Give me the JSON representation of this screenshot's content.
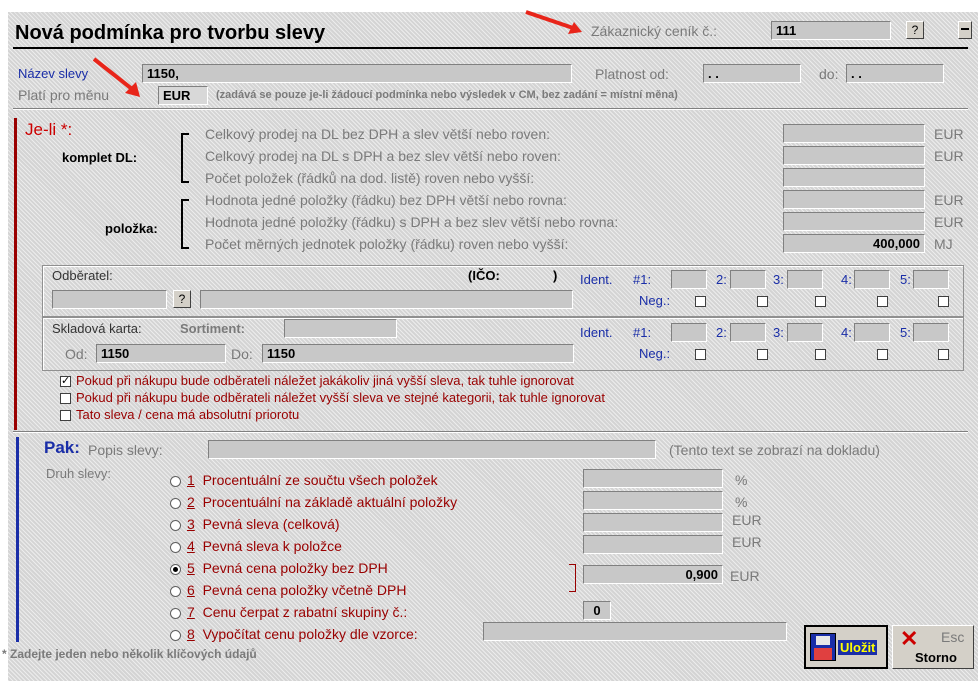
{
  "title": "Nová podmínka pro tvorbu slevy",
  "customer_pricelist": {
    "label": "Zákaznický ceník č.:",
    "value": "111",
    "help": "?"
  },
  "header": {
    "name_label": "Název slevy",
    "name_value": "1150,",
    "valid_from_label": "Platnost od:",
    "valid_from_value": ". .",
    "valid_to_label": "do:",
    "valid_to_value": ". .",
    "currency_label": "Platí pro měnu",
    "currency_value": "EUR",
    "currency_note": "(zadává se pouze je-li žádoucí podmínka nebo výsledek v CM, bez zadání = místní měna)"
  },
  "condition": {
    "heading": "Je-li *:",
    "group_dl": "komplet DL:",
    "group_item": "položka:",
    "rows": [
      {
        "text": "Celkový prodej na DL bez DPH a slev větší nebo roven:",
        "value": "",
        "unit": "EUR"
      },
      {
        "text": "Celkový prodej na DL s DPH a bez slev větší nebo roven:",
        "value": "",
        "unit": "EUR"
      },
      {
        "text": "Počet položek (řádků na dod. listě) roven nebo vyšší:",
        "value": "",
        "unit": ""
      },
      {
        "text": "Hodnota jedné položky (řádku) bez DPH větší nebo rovna:",
        "value": "",
        "unit": "EUR"
      },
      {
        "text": "Hodnota jedné položky (řádku) s DPH a bez slev větší nebo rovna:",
        "value": "",
        "unit": "EUR"
      },
      {
        "text": "Počet měrných jednotek položky (řádku) roven nebo vyšší:",
        "value": "400,000",
        "unit": "MJ"
      }
    ],
    "customer": {
      "label": "Odběratel:",
      "ico_label": "(IČO:",
      "ico_close": ")",
      "help": "?"
    },
    "stock": {
      "label": "Skladová karta:",
      "assortment_label": "Sortiment:",
      "from_label": "Od:",
      "from_value": "1150",
      "to_label": "Do:",
      "to_value": "1150"
    },
    "ident": {
      "label": "Ident.",
      "neg_label": "Neg.:",
      "slots": [
        "#1:",
        "2:",
        "3:",
        "4:",
        "5:"
      ]
    },
    "options": [
      {
        "text": "Pokud při nákupu bude odběrateli náležet jakákoliv jiná vyšší sleva, tak tuhle ignorovat",
        "checked": true
      },
      {
        "text": "Pokud při nákupu bude odběrateli náležet vyšší sleva ve stejné kategorii, tak tuhle ignorovat",
        "checked": false
      },
      {
        "text": "Tato sleva / cena má absolutní priorotu",
        "checked": false
      }
    ]
  },
  "result": {
    "heading": "Pak:",
    "desc_label": "Popis slevy:",
    "desc_note": "(Tento text se zobrazí na dokladu)",
    "type_label": "Druh slevy:",
    "types": [
      {
        "num": "1",
        "text": "Procentuální ze součtu všech položek",
        "selected": false
      },
      {
        "num": "2",
        "text": "Procentuální na základě aktuální položky",
        "selected": false
      },
      {
        "num": "3",
        "text": "Pevná sleva (celková)",
        "selected": false
      },
      {
        "num": "4",
        "text": "Pevná sleva k položce",
        "selected": false
      },
      {
        "num": "5",
        "text": "Pevná cena položky bez DPH",
        "selected": true
      },
      {
        "num": "6",
        "text": "Pevná cena položky včetně DPH",
        "selected": false
      },
      {
        "num": "7",
        "text": "Cenu čerpat z rabatní skupiny č.:",
        "selected": false
      },
      {
        "num": "8",
        "text": "Vypočítat cenu položky dle vzorce:",
        "selected": false
      }
    ],
    "units": [
      "%",
      "%",
      "EUR",
      "EUR"
    ],
    "price_value": "0,900",
    "price_unit": "EUR",
    "rabate_group_value": "0"
  },
  "footer": {
    "note": "* Zadejte jeden nebo několik klíčových údajů",
    "save_label": "Uložit",
    "cancel_label": "Storno",
    "esc_label": "Esc"
  },
  "colors": {
    "accent_red": "#990000",
    "accent_blue": "#1a2ea8",
    "annotation_arrow": "#e8251a"
  }
}
